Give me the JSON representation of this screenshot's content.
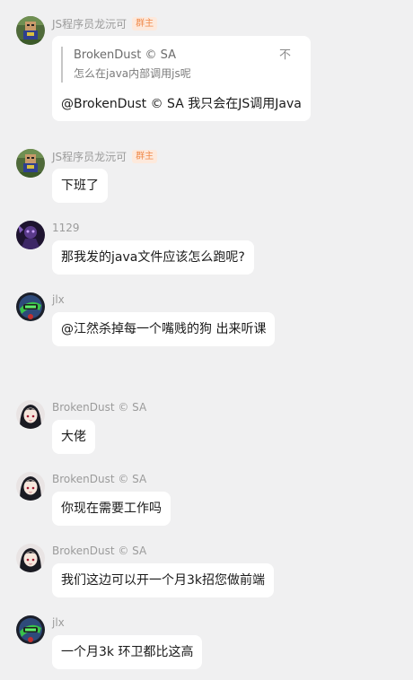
{
  "messages": [
    {
      "sender": "JS程序员龙沅可",
      "badge": "群主",
      "avatar": "pixel-avatar-icon",
      "reply": {
        "author": "BrokenDust © SA",
        "text": "怎么在java内部调用js呢",
        "close": "不"
      },
      "text": "@BrokenDust © SA 我只会在JS调用Java"
    },
    {
      "sender": "JS程序员龙沅可",
      "badge": "群主",
      "avatar": "pixel-avatar-icon",
      "text": "下班了"
    },
    {
      "sender": "1129",
      "avatar": "purple-avatar-icon",
      "text": "那我发的java文件应该怎么跑呢?"
    },
    {
      "sender": "jlx",
      "avatar": "emblem-avatar-icon",
      "text": "@江然杀掉每一个嘴贱的狗 出来听课"
    },
    {
      "sender": "BrokenDust © SA",
      "avatar": "anime-girl-avatar-icon",
      "text": "大佬"
    },
    {
      "sender": "BrokenDust © SA",
      "avatar": "anime-girl-avatar-icon",
      "text": "你现在需要工作吗"
    },
    {
      "sender": "BrokenDust © SA",
      "avatar": "anime-girl-avatar-icon",
      "text": "我们这边可以开一个月3k招您做前端"
    },
    {
      "sender": "jlx",
      "avatar": "emblem-avatar-icon",
      "text": "一个月3k 环卫都比这高"
    }
  ]
}
